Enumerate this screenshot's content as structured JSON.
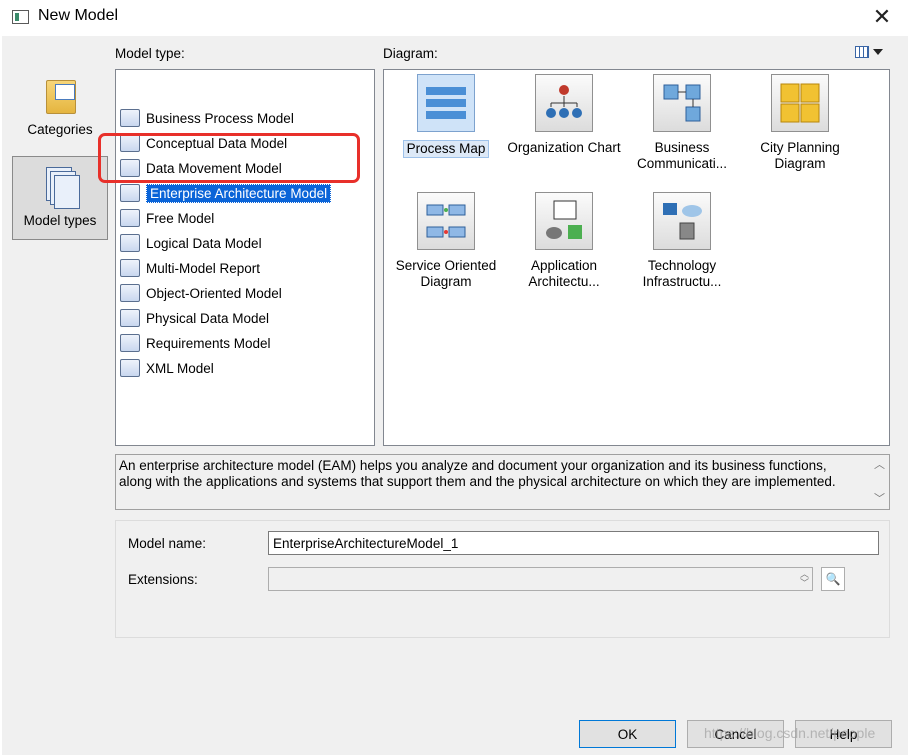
{
  "window": {
    "title": "New Model",
    "close_symbol": "✕"
  },
  "left_pane": {
    "categories_label": "Categories",
    "model_types_label": "Model types"
  },
  "model_type": {
    "label": "Model type:",
    "items": [
      {
        "label": "Business Process Model",
        "icon": "bpm-icon"
      },
      {
        "label": "Conceptual Data Model",
        "icon": "cdm-icon"
      },
      {
        "label": "Data Movement Model",
        "icon": "dmm-icon"
      },
      {
        "label": "Enterprise Architecture Model",
        "icon": "eam-icon",
        "selected": true
      },
      {
        "label": "Free Model",
        "icon": "free-model-icon"
      },
      {
        "label": "Logical Data Model",
        "icon": "ldm-icon"
      },
      {
        "label": "Multi-Model Report",
        "icon": "report-icon"
      },
      {
        "label": "Object-Oriented Model",
        "icon": "oom-icon"
      },
      {
        "label": "Physical Data Model",
        "icon": "pdm-icon"
      },
      {
        "label": "Requirements Model",
        "icon": "requirements-icon"
      },
      {
        "label": "XML Model",
        "icon": "xml-icon"
      }
    ]
  },
  "diagram": {
    "label": "Diagram:",
    "items": [
      {
        "label": "Process Map",
        "icon": "process-map-icon",
        "selected": true
      },
      {
        "label": "Organization Chart",
        "icon": "org-chart-icon"
      },
      {
        "label": "Business Communicati...",
        "icon": "business-communication-icon"
      },
      {
        "label": "City Planning Diagram",
        "icon": "city-planning-icon"
      },
      {
        "label": "Service Oriented Diagram",
        "icon": "service-oriented-icon"
      },
      {
        "label": "Application Architectu...",
        "icon": "application-architecture-icon"
      },
      {
        "label": "Technology Infrastructu...",
        "icon": "technology-infrastructure-icon"
      }
    ]
  },
  "description": "An enterprise architecture model (EAM) helps you analyze and document your organization and its business functions, along with the applications and systems that support them and the physical architecture on which they are implemented.",
  "form": {
    "model_name_label": "Model name:",
    "model_name_value": "EnterpriseArchitectureModel_1",
    "extensions_label": "Extensions:",
    "extensions_value": ""
  },
  "buttons": {
    "ok": "OK",
    "cancel": "Cancel",
    "help": "Help"
  },
  "watermark": "https://blog.csdn.net/people",
  "colors": {
    "selection": "#0a64d8",
    "highlight_box": "#e8302a"
  }
}
